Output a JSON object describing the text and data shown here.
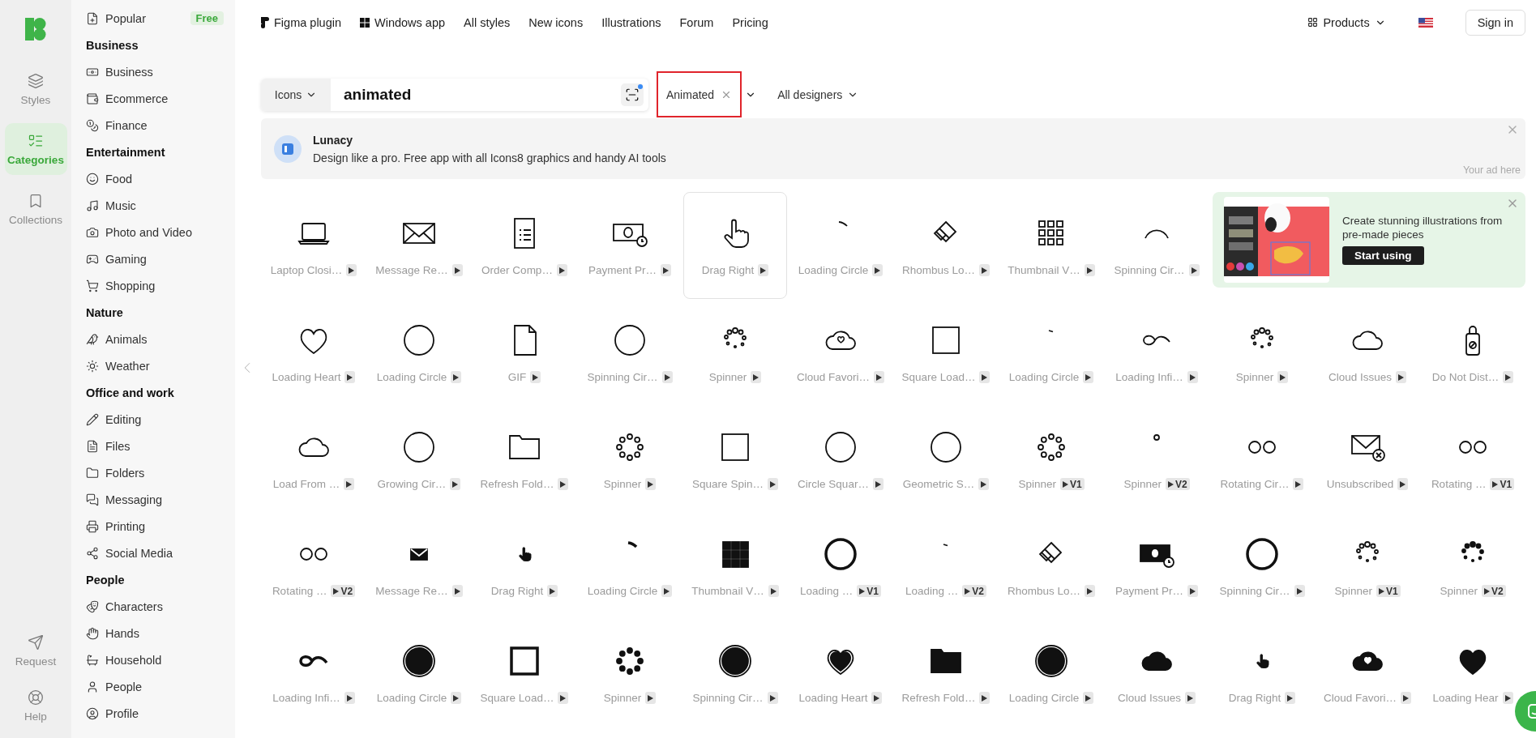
{
  "rail": {
    "items": [
      {
        "label": "Styles",
        "selected": false
      },
      {
        "label": "Categories",
        "selected": true
      },
      {
        "label": "Collections",
        "selected": false
      }
    ],
    "bottom_items": [
      {
        "label": "Request"
      },
      {
        "label": "Help"
      }
    ]
  },
  "sidebar": {
    "popular": {
      "label": "Popular",
      "badge": "Free"
    },
    "groups": [
      {
        "title": "Business",
        "items": [
          "Business",
          "Ecommerce",
          "Finance"
        ]
      },
      {
        "title": "Entertainment",
        "items": [
          "Food",
          "Music",
          "Photo and Video",
          "Gaming",
          "Shopping"
        ]
      },
      {
        "title": "Nature",
        "items": [
          "Animals",
          "Weather"
        ]
      },
      {
        "title": "Office and work",
        "items": [
          "Editing",
          "Files",
          "Folders",
          "Messaging",
          "Printing",
          "Social Media"
        ]
      },
      {
        "title": "People",
        "items": [
          "Characters",
          "Hands",
          "Household",
          "People",
          "Profile"
        ]
      }
    ]
  },
  "nav": {
    "links": [
      {
        "label": "Figma plugin",
        "kind": "figma"
      },
      {
        "label": "Windows app",
        "kind": "windows"
      },
      {
        "label": "All styles",
        "kind": "text"
      },
      {
        "label": "New icons",
        "kind": "text"
      },
      {
        "label": "Illustrations",
        "kind": "text"
      },
      {
        "label": "Forum",
        "kind": "text"
      },
      {
        "label": "Pricing",
        "kind": "text"
      }
    ],
    "products": "Products",
    "sign_in": "Sign in"
  },
  "search": {
    "type": "Icons",
    "value": "animated",
    "filter": {
      "label": "Animated",
      "highlighted": true
    },
    "designers": "All designers"
  },
  "ad": {
    "title": "Lunacy",
    "text": "Design like a pro. Free app with all Icons8 graphics and handy AI tools",
    "note": "Your ad here"
  },
  "promo": {
    "text": "Create stunning illustrations from pre-made pieces",
    "button": "Start using"
  },
  "icons": [
    {
      "label": "Laptop Closi…",
      "hovered": false
    },
    {
      "label": "Message Re…",
      "hovered": false
    },
    {
      "label": "Order Comp…",
      "hovered": false
    },
    {
      "label": "Payment Pr…",
      "hovered": false
    },
    {
      "label": "Drag Right",
      "hovered": true
    },
    {
      "label": "Loading Circle",
      "hovered": false
    },
    {
      "label": "Rhombus Lo…",
      "hovered": false
    },
    {
      "label": "Thumbnail V…",
      "hovered": false
    },
    {
      "label": "Spinning Cir…",
      "hovered": false
    },
    {
      "label": "Loading Heart",
      "hovered": false
    },
    {
      "label": "Loading Circle",
      "hovered": false
    },
    {
      "label": "GIF",
      "hovered": false
    },
    {
      "label": "Spinning Cir…",
      "hovered": false
    },
    {
      "label": "Spinner",
      "hovered": false
    },
    {
      "label": "Cloud Favori…",
      "hovered": false
    },
    {
      "label": "Square Load…",
      "hovered": false
    },
    {
      "label": "Loading Circle",
      "hovered": false
    },
    {
      "label": "Loading Infi…",
      "hovered": false
    },
    {
      "label": "Spinner",
      "hovered": false
    },
    {
      "label": "Cloud Issues",
      "hovered": false
    },
    {
      "label": "Do Not Dist…",
      "hovered": false
    },
    {
      "label": "Load From …",
      "hovered": false
    },
    {
      "label": "Growing Cir…",
      "hovered": false
    },
    {
      "label": "Refresh Fold…",
      "hovered": false
    },
    {
      "label": "Spinner",
      "hovered": false
    },
    {
      "label": "Square Spin…",
      "hovered": false
    },
    {
      "label": "Circle Squar…",
      "hovered": false
    },
    {
      "label": "Geometric S…",
      "hovered": false
    },
    {
      "label": "Spinner",
      "hovered": false,
      "version": "V1"
    },
    {
      "label": "Spinner",
      "hovered": false,
      "version": "V2"
    },
    {
      "label": "Rotating Cir…",
      "hovered": false
    },
    {
      "label": "Unsubscribed",
      "hovered": false
    },
    {
      "label": "Rotating …",
      "hovered": false,
      "version": "V1"
    },
    {
      "label": "Rotating …",
      "hovered": false,
      "version": "V2"
    },
    {
      "label": "Message Re…",
      "hovered": false
    },
    {
      "label": "Drag Right",
      "hovered": false
    },
    {
      "label": "Loading Circle",
      "hovered": false
    },
    {
      "label": "Thumbnail V…",
      "hovered": false
    },
    {
      "label": "Loading …",
      "hovered": false,
      "version": "V1"
    },
    {
      "label": "Loading …",
      "hovered": false,
      "version": "V2"
    },
    {
      "label": "Rhombus Lo…",
      "hovered": false
    },
    {
      "label": "Payment Pr…",
      "hovered": false
    },
    {
      "label": "Spinning Cir…",
      "hovered": false
    },
    {
      "label": "Spinner",
      "hovered": false,
      "version": "V1"
    },
    {
      "label": "Spinner",
      "hovered": false,
      "version": "V2"
    },
    {
      "label": "Loading Infi…",
      "hovered": false
    },
    {
      "label": "Loading Circle",
      "hovered": false
    },
    {
      "label": "Square Load…",
      "hovered": false
    },
    {
      "label": "Spinner",
      "hovered": false
    },
    {
      "label": "Spinning Cir…",
      "hovered": false
    },
    {
      "label": "Loading Heart",
      "hovered": false
    },
    {
      "label": "Refresh Fold…",
      "hovered": false
    },
    {
      "label": "Loading Circle",
      "hovered": false
    },
    {
      "label": "Cloud Issues",
      "hovered": false
    },
    {
      "label": "Drag Right",
      "hovered": false
    },
    {
      "label": "Cloud Favori…",
      "hovered": false
    },
    {
      "label": "Loading Hear",
      "hovered": false
    }
  ]
}
